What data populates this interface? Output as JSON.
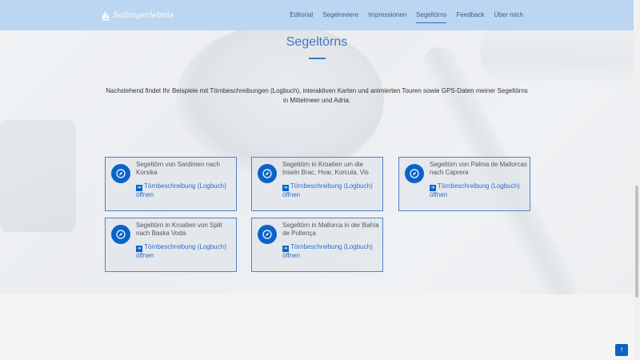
{
  "brand": {
    "logo_text": "Sailingerlebnis"
  },
  "nav": {
    "items": [
      {
        "label": "Editorial",
        "active": false
      },
      {
        "label": "Segelreviere",
        "active": false
      },
      {
        "label": "Impressionen",
        "active": false
      },
      {
        "label": "Segeltörns",
        "active": true
      },
      {
        "label": "Feedback",
        "active": false
      },
      {
        "label": "Über mich",
        "active": false
      }
    ]
  },
  "page": {
    "title": "Segeltörns",
    "intro": "Nachstehend findet Ihr Beispiele mit Törnbeschreibungen (Logbuch), interaktiven Karten und animierten Touren sowie GPS-Daten meiner Segeltörns in Mittelmeer und Adria:"
  },
  "cards": [
    {
      "title": "Segeltörn von Sardinien nach Korsika",
      "link": "Törnbeschreibung (Logbuch) öffnen"
    },
    {
      "title": "Segeltörn in Kroatien um die Inseln Brac, Hvar, Korcula, Vis",
      "link": "Törnbeschreibung (Logbuch) öffnen"
    },
    {
      "title": "Segeltörn von Palma de Mallorcas nach Caprera",
      "link": "Törnbeschreibung (Logbuch) öffnen"
    },
    {
      "title": "Segeltörn in Kroatien von Split nach Baska Voda",
      "link": "Törnbeschreibung (Logbuch) öffnen"
    },
    {
      "title": "Segeltörn in Mallorca in der Bahía de Pollença",
      "link": "Törnbeschreibung (Logbuch) öffnen"
    }
  ],
  "icons": {
    "card_badge": "compass-icon",
    "link_arrow": "arrow-right-icon",
    "back_to_top": "arrow-up-icon"
  },
  "colors": {
    "navbar": "#bcd5f1",
    "accent": "#3b79c4",
    "badge": "#0b63c9",
    "card_border": "#4d82c9"
  }
}
